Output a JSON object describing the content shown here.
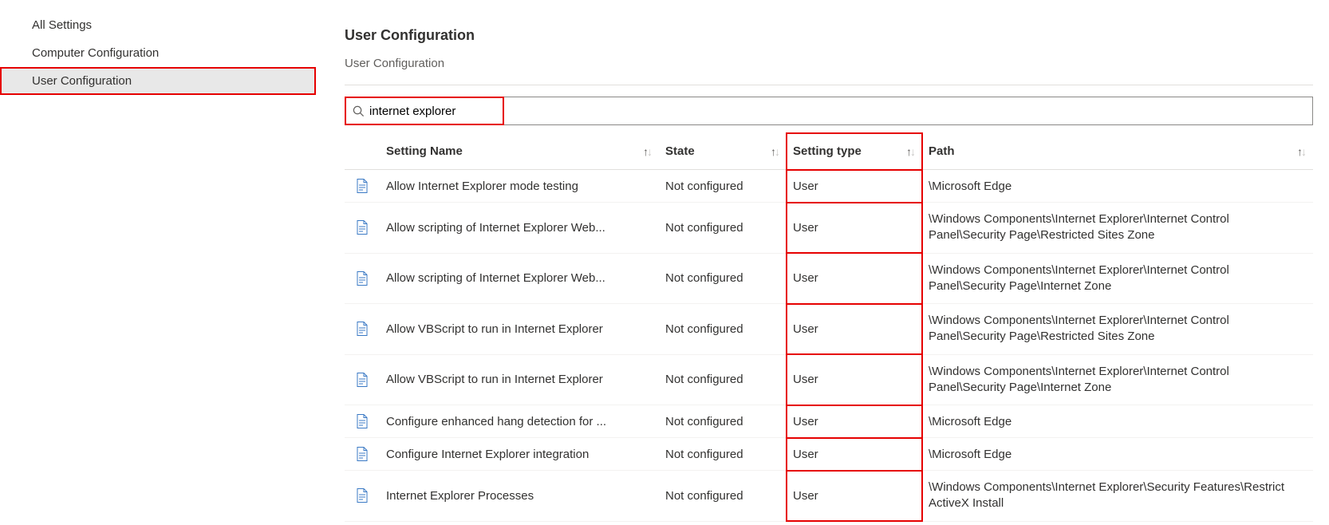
{
  "sidebar": {
    "items": [
      {
        "label": "All Settings",
        "selected": false,
        "highlight": false
      },
      {
        "label": "Computer Configuration",
        "selected": false,
        "highlight": false
      },
      {
        "label": "User Configuration",
        "selected": true,
        "highlight": true
      }
    ]
  },
  "header": {
    "title": "User Configuration",
    "breadcrumb": "User Configuration"
  },
  "search": {
    "value": "internet explorer",
    "placeholder": ""
  },
  "columns": {
    "name": "Setting Name",
    "state": "State",
    "type": "Setting type",
    "path": "Path"
  },
  "rows": [
    {
      "name": "Allow Internet Explorer mode testing",
      "state": "Not configured",
      "type": "User",
      "path": "\\Microsoft Edge"
    },
    {
      "name": "Allow scripting of Internet Explorer Web...",
      "state": "Not configured",
      "type": "User",
      "path": "\\Windows Components\\Internet Explorer\\Internet Control Panel\\Security Page\\Restricted Sites Zone"
    },
    {
      "name": "Allow scripting of Internet Explorer Web...",
      "state": "Not configured",
      "type": "User",
      "path": "\\Windows Components\\Internet Explorer\\Internet Control Panel\\Security Page\\Internet Zone"
    },
    {
      "name": "Allow VBScript to run in Internet Explorer",
      "state": "Not configured",
      "type": "User",
      "path": "\\Windows Components\\Internet Explorer\\Internet Control Panel\\Security Page\\Restricted Sites Zone"
    },
    {
      "name": "Allow VBScript to run in Internet Explorer",
      "state": "Not configured",
      "type": "User",
      "path": "\\Windows Components\\Internet Explorer\\Internet Control Panel\\Security Page\\Internet Zone"
    },
    {
      "name": "Configure enhanced hang detection for ...",
      "state": "Not configured",
      "type": "User",
      "path": "\\Microsoft Edge"
    },
    {
      "name": "Configure Internet Explorer integration",
      "state": "Not configured",
      "type": "User",
      "path": "\\Microsoft Edge"
    },
    {
      "name": "Internet Explorer Processes",
      "state": "Not configured",
      "type": "User",
      "path": "\\Windows Components\\Internet Explorer\\Security Features\\Restrict ActiveX Install"
    }
  ]
}
